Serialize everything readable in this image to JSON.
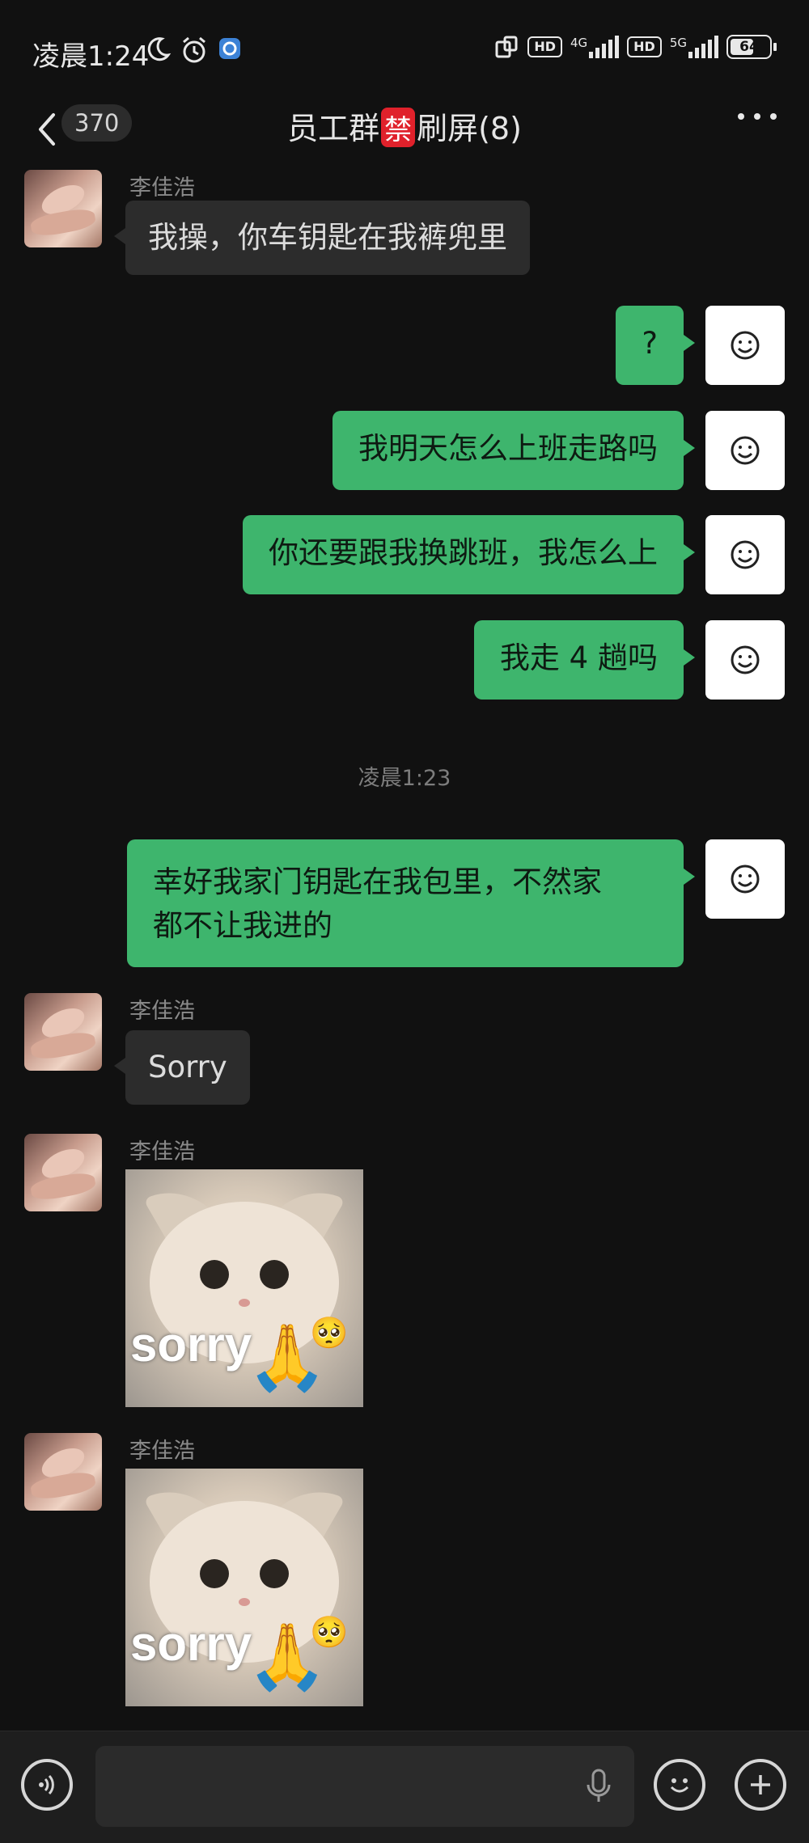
{
  "status_bar": {
    "time": "凌晨1:24",
    "network_1": "4G",
    "network_2": "5G",
    "hd": "HD",
    "battery": "64"
  },
  "header": {
    "unread_count": "370",
    "title_prefix": "员工群",
    "title_ban_emoji": "禁",
    "title_suffix": "刷屏(8)"
  },
  "messages": {
    "m1": {
      "sender": "李佳浩",
      "text": "我操，你车钥匙在我裤兜里"
    },
    "m2": {
      "text": "?"
    },
    "m3": {
      "text": "我明天怎么上班走路吗"
    },
    "m4": {
      "text": "你还要跟我换跳班，我怎么上"
    },
    "m5": {
      "text": "我走 4 趟吗"
    },
    "timestamp": "凌晨1:23",
    "m6": {
      "line1": "幸好我家门钥匙在我包里，不然家",
      "line2": "都不让我进的"
    },
    "m7": {
      "sender": "李佳浩",
      "text": "Sorry"
    },
    "m8": {
      "sender": "李佳浩",
      "sticker_text": "sorry"
    },
    "m9": {
      "sender": "李佳浩",
      "sticker_text": "sorry"
    }
  }
}
